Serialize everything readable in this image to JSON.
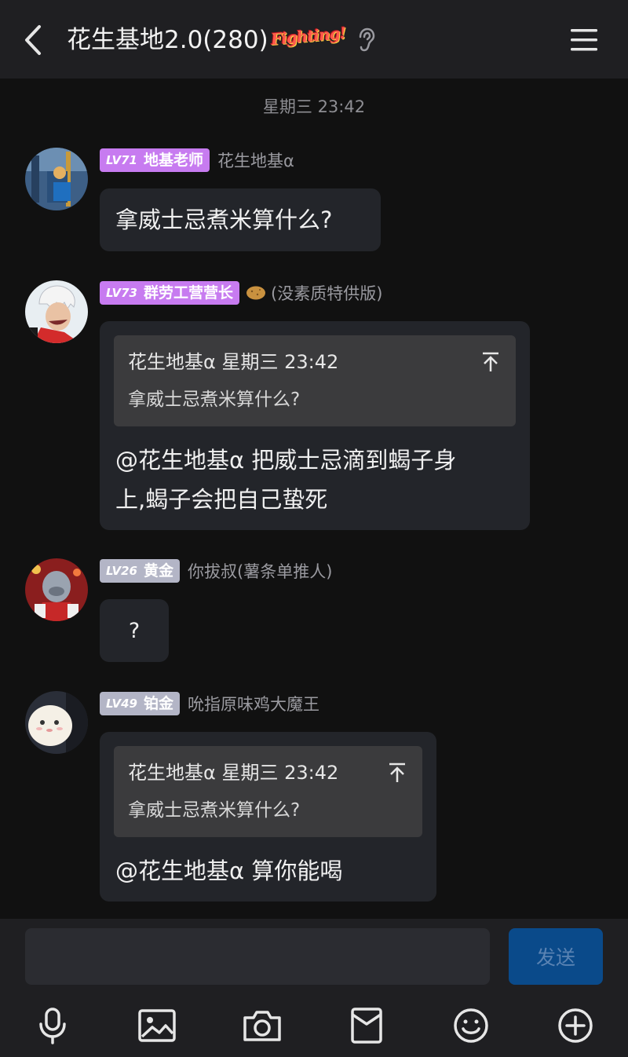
{
  "header": {
    "title": "花生基地2.0(280)",
    "badge_text": "Fighting!"
  },
  "chat": {
    "timestamp": "星期三 23:42",
    "messages": [
      {
        "level": "LV71",
        "title": "地基老师",
        "badge_color": "#c77bf0",
        "nickname": "花生地基α",
        "text": "拿威士忌煮米算什么?"
      },
      {
        "level": "LV73",
        "title": "群劳工营营长",
        "badge_color": "#c77bf0",
        "nickname": "(没素质特供版)",
        "nickname_icon": "potato-icon",
        "quote": {
          "sender_time": "花生地基α 星期三 23:42",
          "text": "拿威士忌煮米算什么?"
        },
        "lines": [
          "@花生地基α 把威士忌滴到蝎子身",
          "上,蝎子会把自己蛰死"
        ]
      },
      {
        "level": "LV26",
        "title": "黄金",
        "badge_color": "#b3b5c6",
        "nickname": "你拔叔(薯条单推人)",
        "text": "?"
      },
      {
        "level": "LV49",
        "title": "铂金",
        "badge_color": "#b3b5c6",
        "nickname": "吮指原味鸡大魔王",
        "quote": {
          "sender_time": "花生地基α 星期三 23:42",
          "text": "拿威士忌煮米算什么?"
        },
        "lines": [
          "@花生地基α 算你能喝"
        ]
      }
    ]
  },
  "input": {
    "value": "",
    "placeholder": "",
    "send_label": "发送"
  },
  "toolbar": [
    "microphone-icon",
    "image-icon",
    "camera-icon",
    "red-packet-icon",
    "emoji-icon",
    "plus-icon"
  ],
  "colors": {
    "background": "#111111",
    "header": "#1f1f22",
    "bubble": "#23252a",
    "quote": "#3b3b3d",
    "send_button": "#0a4a8a"
  }
}
